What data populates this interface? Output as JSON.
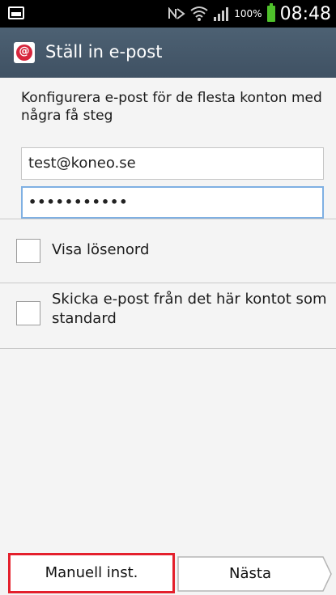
{
  "status_bar": {
    "battery_percent": "100%",
    "time": "08:48",
    "battery_color": "#4fc12b",
    "icons": [
      "screenshot-icon",
      "nfc-icon",
      "wifi-icon",
      "signal-icon",
      "battery-icon"
    ]
  },
  "title_bar": {
    "title": "Ställ in e-post",
    "icon": "email-app-icon",
    "background": "#455a6b"
  },
  "form": {
    "intro": "Konfigurera e-post för de flesta konton med några få steg",
    "email_value": "test@koneo.se",
    "password_value": "•••••••••••",
    "show_password_label": "Visa lösenord",
    "default_account_label": "Skicka e-post från det här kontot som standard"
  },
  "buttons": {
    "manual_label": "Manuell inst.",
    "next_label": "Nästa",
    "highlight_color": "#e4202c"
  }
}
